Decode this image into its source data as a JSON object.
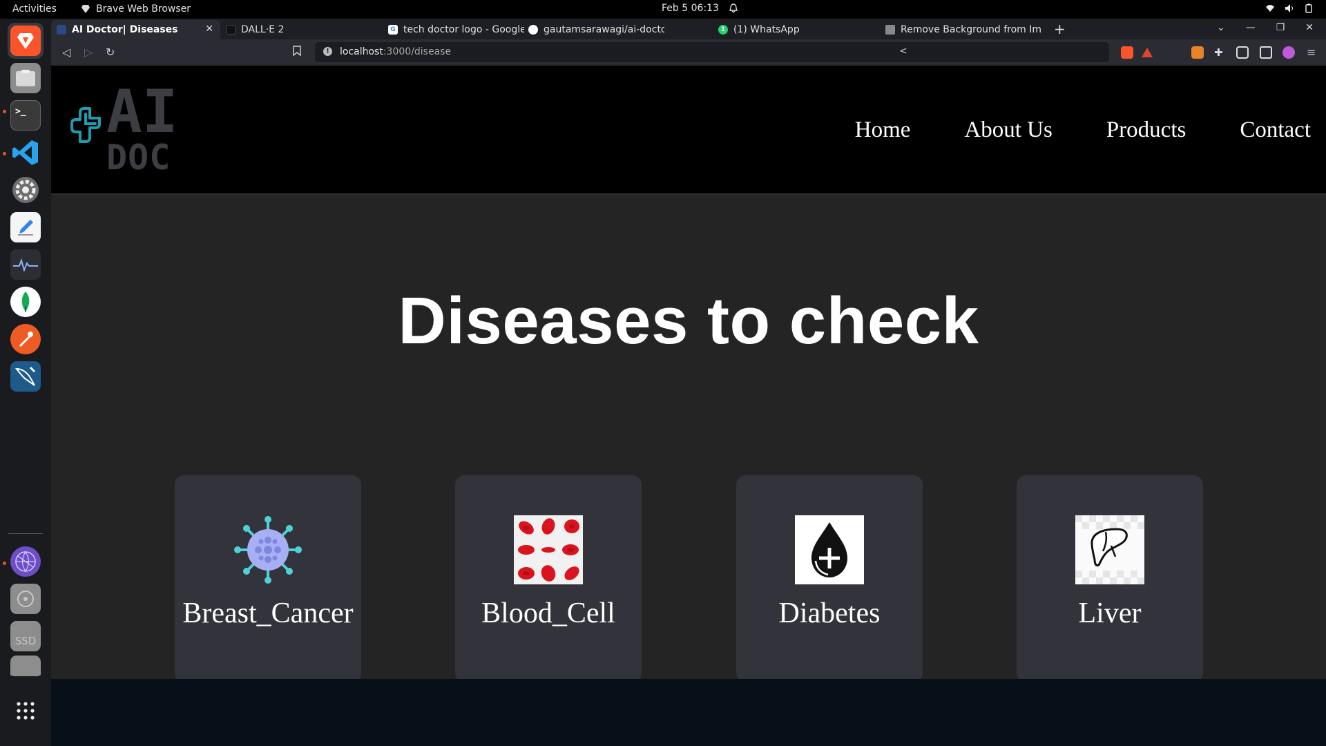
{
  "os": {
    "activities": "Activities",
    "app_name": "Brave Web Browser",
    "clock": "Feb 5  06:13"
  },
  "dock": {
    "items": [
      "brave",
      "files",
      "terminal",
      "vscode",
      "settings",
      "text-editor",
      "system-monitor",
      "mongodb-compass",
      "postman",
      "mysql-workbench",
      "network",
      "disk",
      "ssd-drive",
      "drive",
      "show-apps"
    ],
    "ssd_label": "SSD"
  },
  "browser": {
    "tabs": [
      {
        "title": "AI Doctor| Diseases",
        "active": true
      },
      {
        "title": "DALL·E 2",
        "active": false
      },
      {
        "title": "tech doctor logo - Google Sea",
        "active": false
      },
      {
        "title": "gautamsarawagi/ai-doctor",
        "active": false
      },
      {
        "title": "(1) WhatsApp",
        "active": false
      },
      {
        "title": "Remove Background from Im",
        "active": false
      }
    ],
    "url_host": "localhost",
    "url_path": ":3000/disease"
  },
  "site": {
    "logo": {
      "line1": "AI",
      "line2": "DOC"
    },
    "nav": [
      "Home",
      "About Us",
      "Products",
      "Contact"
    ],
    "heading": "Diseases to check",
    "cards": [
      {
        "label": "Breast_Cancer",
        "icon": "virus-icon"
      },
      {
        "label": "Blood_Cell",
        "icon": "blood-cells-icon"
      },
      {
        "label": "Diabetes",
        "icon": "blood-drop-plus-icon"
      },
      {
        "label": "Liver",
        "icon": "liver-icon"
      }
    ]
  },
  "colors": {
    "accent_logo": "#1f9cb2",
    "card_bg": "#33343b",
    "page_bg": "#242424",
    "header_bg": "#000000",
    "footer_bg": "#071019"
  }
}
